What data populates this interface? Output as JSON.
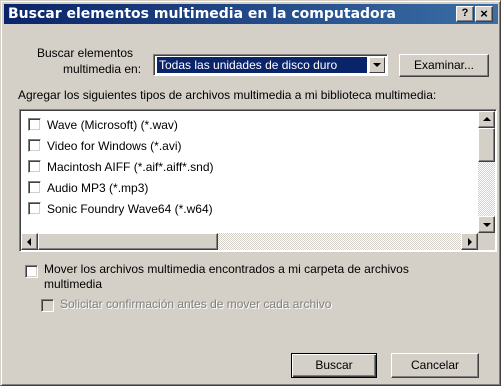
{
  "window": {
    "title": "Buscar elementos multimedia en la computadora",
    "help_glyph": "?",
    "close_glyph": "×"
  },
  "search_in": {
    "label_line1": "Buscar elementos",
    "label_line2": "multimedia en:",
    "selected_value": "Todas las unidades de disco duro",
    "browse_label": "Examinar..."
  },
  "file_types": {
    "heading": "Agregar los siguientes tipos de archivos multimedia a mi biblioteca multimedia:",
    "items": [
      {
        "label": "Wave (Microsoft) (*.wav)",
        "checked": false
      },
      {
        "label": "Video for Windows (*.avi)",
        "checked": false
      },
      {
        "label": "Macintosh AIFF (*.aif*.aiff*.snd)",
        "checked": false
      },
      {
        "label": "Audio MP3 (*.mp3)",
        "checked": false
      },
      {
        "label": "Sonic Foundry Wave64 (*.w64)",
        "checked": false
      }
    ]
  },
  "options": {
    "move_files_line1": "Mover los archivos multimedia encontrados a mi carpeta de archivos",
    "move_files_line2": "multimedia",
    "move_files_checked": false,
    "confirm_move": "Solicitar confirmación antes de mover cada archivo",
    "confirm_move_enabled": false
  },
  "footer": {
    "search_label": "Buscar",
    "cancel_label": "Cancelar"
  },
  "colors": {
    "title_bar": "#0a246a",
    "dialog_face": "#d4d0c8",
    "selection": "#0a246a"
  }
}
